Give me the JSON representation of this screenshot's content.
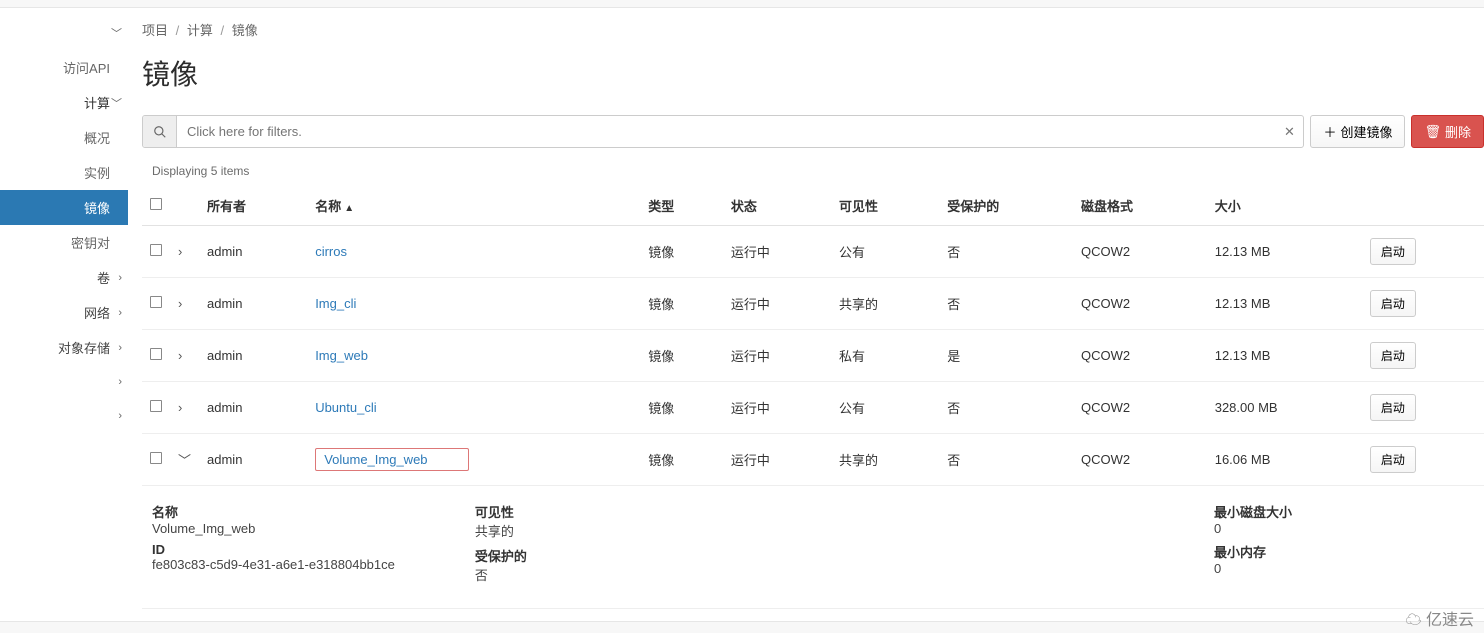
{
  "sidebar": {
    "api": "访问API",
    "compute": "计算",
    "subs": [
      "概况",
      "实例",
      "镜像",
      "密钥对"
    ],
    "volumes": "卷",
    "network": "网络",
    "object_storage": "对象存储"
  },
  "breadcrumb": [
    "项目",
    "计算",
    "镜像"
  ],
  "page_title": "镜像",
  "search": {
    "placeholder": "Click here for filters."
  },
  "buttons": {
    "create": "创建镜像",
    "delete": "删除"
  },
  "count": "Displaying 5 items",
  "columns": {
    "owner": "所有者",
    "name": "名称",
    "type": "类型",
    "status": "状态",
    "visibility": "可见性",
    "protected": "受保护的",
    "disk_format": "磁盘格式",
    "size": "大小",
    "action": "启动"
  },
  "rows": [
    {
      "owner": "admin",
      "name": "cirros",
      "type": "镜像",
      "status": "运行中",
      "visibility": "公有",
      "protected": "否",
      "disk_format": "QCOW2",
      "size": "12.13 MB"
    },
    {
      "owner": "admin",
      "name": "Img_cli",
      "type": "镜像",
      "status": "运行中",
      "visibility": "共享的",
      "protected": "否",
      "disk_format": "QCOW2",
      "size": "12.13 MB"
    },
    {
      "owner": "admin",
      "name": "Img_web",
      "type": "镜像",
      "status": "运行中",
      "visibility": "私有",
      "protected": "是",
      "disk_format": "QCOW2",
      "size": "12.13 MB"
    },
    {
      "owner": "admin",
      "name": "Ubuntu_cli",
      "type": "镜像",
      "status": "运行中",
      "visibility": "公有",
      "protected": "否",
      "disk_format": "QCOW2",
      "size": "328.00 MB"
    },
    {
      "owner": "admin",
      "name": "Volume_Img_web",
      "type": "镜像",
      "status": "运行中",
      "visibility": "共享的",
      "protected": "否",
      "disk_format": "QCOW2",
      "size": "16.06 MB"
    }
  ],
  "details": {
    "labels": {
      "name": "名称",
      "id": "ID",
      "visibility": "可见性",
      "protected": "受保护的",
      "min_disk": "最小磁盘大小",
      "min_ram": "最小内存"
    },
    "values": {
      "name": "Volume_Img_web",
      "id": "fe803c83-c5d9-4e31-a6e1-e318804bb1ce",
      "visibility": "共享的",
      "protected": "否",
      "min_disk": "0",
      "min_ram": "0"
    }
  },
  "brand": "亿速云"
}
